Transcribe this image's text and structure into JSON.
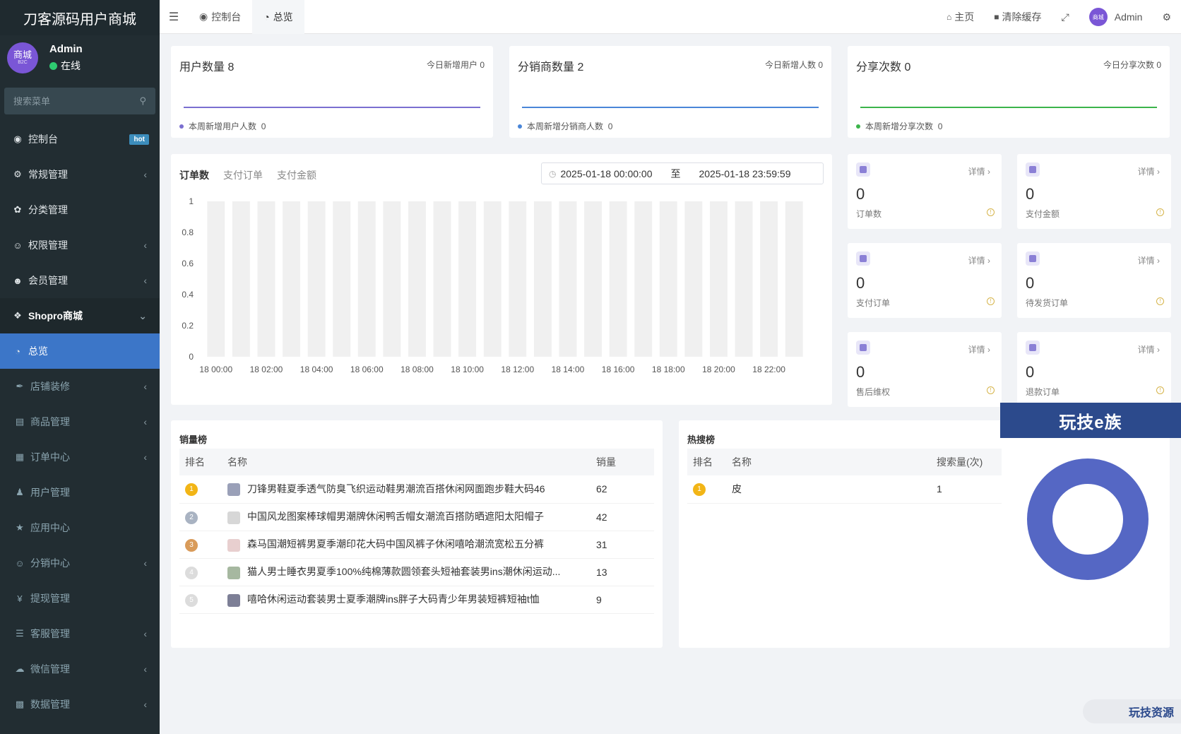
{
  "sidebar": {
    "brand": "刀客源码用户商城",
    "user": {
      "avatar_text": "商城",
      "avatar_sub": "B2C",
      "name": "Admin",
      "status": "在线"
    },
    "search_placeholder": "搜索菜单",
    "items": [
      {
        "label": "控制台",
        "badge": "hot"
      },
      {
        "label": "常规管理"
      },
      {
        "label": "分类管理"
      },
      {
        "label": "权限管理"
      },
      {
        "label": "会员管理"
      },
      {
        "label": "Shopro商城"
      },
      {
        "label": "总览"
      },
      {
        "label": "店铺装修"
      },
      {
        "label": "商品管理"
      },
      {
        "label": "订单中心"
      },
      {
        "label": "用户管理"
      },
      {
        "label": "应用中心"
      },
      {
        "label": "分销中心"
      },
      {
        "label": "提现管理"
      },
      {
        "label": "客服管理"
      },
      {
        "label": "微信管理"
      },
      {
        "label": "数据管理"
      }
    ]
  },
  "topbar": {
    "tabs": [
      {
        "label": "控制台"
      },
      {
        "label": "总览"
      }
    ],
    "home": "主页",
    "clear_cache": "清除缓存",
    "user": "Admin",
    "avatar_text": "商城"
  },
  "stats": [
    {
      "title": "用户数量",
      "value": "8",
      "today_label": "今日新增用户",
      "today_value": "0",
      "week_label": "本周新增用户人数",
      "week_value": "0",
      "color": "#7b6fd0"
    },
    {
      "title": "分销商数量",
      "value": "2",
      "today_label": "今日新增人数",
      "today_value": "0",
      "week_label": "本周新增分销商人数",
      "week_value": "0",
      "color": "#4a86d8"
    },
    {
      "title": "分享次数",
      "value": "0",
      "today_label": "今日分享次数",
      "today_value": "0",
      "week_label": "本周新增分享次数",
      "week_value": "0",
      "color": "#3cb44b"
    }
  ],
  "order_chart": {
    "tabs": [
      "订单数",
      "支付订单",
      "支付金额"
    ],
    "date_start": "2025-01-18 00:00:00",
    "date_sep": "至",
    "date_end": "2025-01-18 23:59:59"
  },
  "chart_data": {
    "type": "bar",
    "categories": [
      "18 00:00",
      "18 01:00",
      "18 02:00",
      "18 03:00",
      "18 04:00",
      "18 05:00",
      "18 06:00",
      "18 07:00",
      "18 08:00",
      "18 09:00",
      "18 10:00",
      "18 11:00",
      "18 12:00",
      "18 13:00",
      "18 14:00",
      "18 15:00",
      "18 16:00",
      "18 17:00",
      "18 18:00",
      "18 19:00",
      "18 20:00",
      "18 21:00",
      "18 22:00",
      "18 23:00"
    ],
    "tick_labels": [
      "18 00:00",
      "18 02:00",
      "18 04:00",
      "18 06:00",
      "18 08:00",
      "18 10:00",
      "18 12:00",
      "18 14:00",
      "18 16:00",
      "18 18:00",
      "18 20:00",
      "18 22:00"
    ],
    "values": [
      0,
      0,
      0,
      0,
      0,
      0,
      0,
      0,
      0,
      0,
      0,
      0,
      0,
      0,
      0,
      0,
      0,
      0,
      0,
      0,
      0,
      0,
      0,
      0
    ],
    "y_ticks": [
      "0",
      "0.2",
      "0.4",
      "0.6",
      "0.8",
      "1"
    ],
    "ylim": [
      0,
      1
    ],
    "bar_color": "#f0f0f0"
  },
  "mini_cards": [
    {
      "value": "0",
      "label": "订单数",
      "detail": "详情"
    },
    {
      "value": "0",
      "label": "支付金额",
      "detail": "详情"
    },
    {
      "value": "0",
      "label": "支付订单",
      "detail": "详情"
    },
    {
      "value": "0",
      "label": "待发货订单",
      "detail": "详情"
    },
    {
      "value": "0",
      "label": "售后维权",
      "detail": "详情"
    },
    {
      "value": "0",
      "label": "退款订单",
      "detail": "详情"
    }
  ],
  "sales_rank": {
    "title": "销量榜",
    "headers": [
      "排名",
      "名称",
      "销量"
    ],
    "rows": [
      {
        "rank": "1",
        "name": "刀锋男鞋夏季透气防臭飞织运动鞋男潮流百搭休闲网面跑步鞋大码46",
        "sales": "62"
      },
      {
        "rank": "2",
        "name": "中国风龙图案棒球帽男潮牌休闲鸭舌帽女潮流百搭防晒遮阳太阳帽子",
        "sales": "42"
      },
      {
        "rank": "3",
        "name": "森马国潮短裤男夏季潮印花大码中国风裤子休闲嘻哈潮流宽松五分裤",
        "sales": "31"
      },
      {
        "rank": "4",
        "name": "猫人男士睡衣男夏季100%纯棉薄款圆领套头短袖套装男ins潮休闲运动...",
        "sales": "13"
      },
      {
        "rank": "5",
        "name": "嘻哈休闲运动套装男士夏季潮牌ins胖子大码青少年男装短裤短袖t恤",
        "sales": "9"
      }
    ]
  },
  "search_rank": {
    "title": "热搜榜",
    "headers": [
      "排名",
      "名称",
      "搜索量(次)"
    ],
    "rows": [
      {
        "rank": "1",
        "name": "皮",
        "count": "1"
      }
    ]
  },
  "donut": {
    "color": "#5567c4",
    "value": 1
  },
  "watermarks": {
    "top": "玩技e族",
    "bottom": "玩技资源"
  }
}
